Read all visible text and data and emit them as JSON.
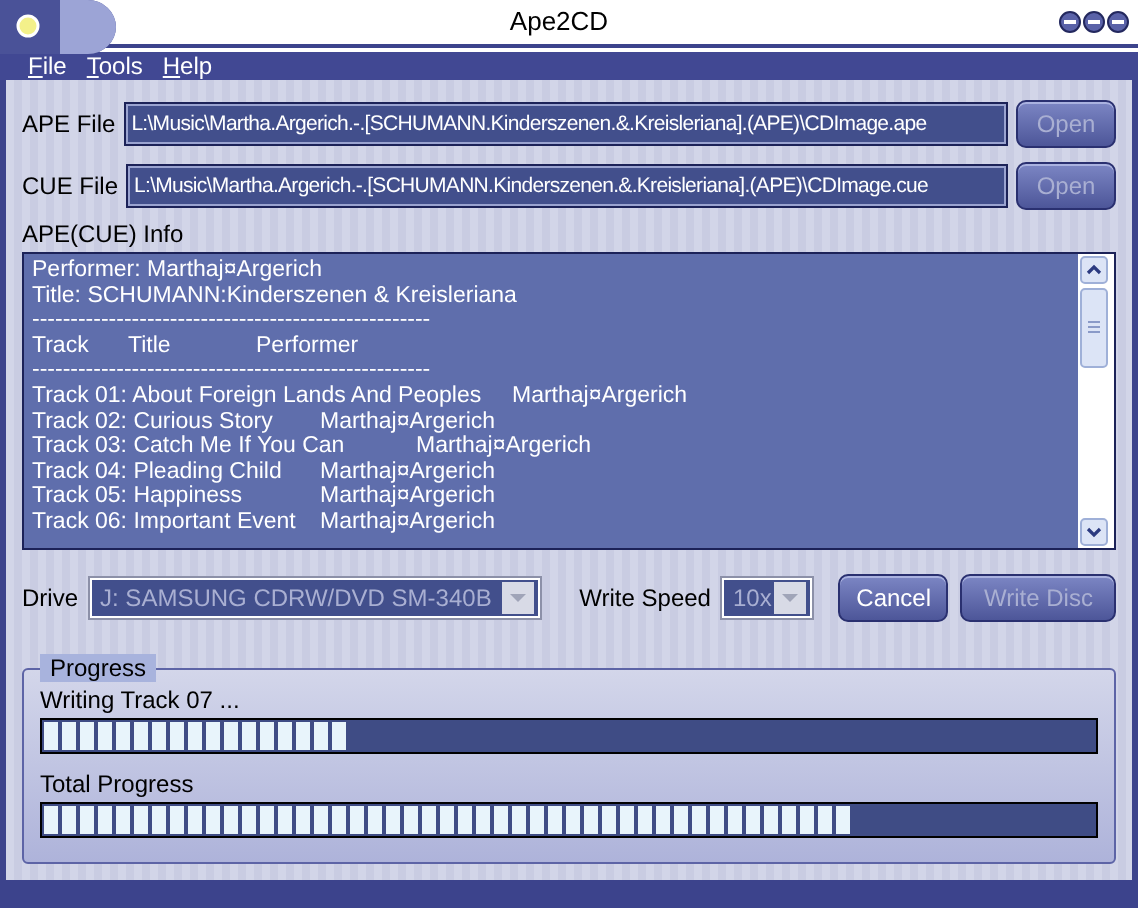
{
  "window": {
    "title": "Ape2CD"
  },
  "menu": [
    {
      "label": "File"
    },
    {
      "label": "Tools"
    },
    {
      "label": "Help"
    }
  ],
  "files": [
    {
      "label": "APE File",
      "value": "L:\\Music\\Martha.Argerich.-.[SCHUMANN.Kinderszenen.&.Kreisleriana].(APE)\\CDImage.ape",
      "button": {
        "label": "Open",
        "disabled": true
      }
    },
    {
      "label": "CUE File",
      "value": "L:\\Music\\Martha.Argerich.-.[SCHUMANN.Kinderszenen.&.Kreisleriana].(APE)\\CDImage.cue",
      "button": {
        "label": "Open",
        "disabled": true
      }
    }
  ],
  "info": {
    "label": "APE(CUE) Info",
    "lines": [
      {
        "kind": "text",
        "text": "Performer: Marthaj¤Argerich"
      },
      {
        "kind": "text",
        "text": "Title: SCHUMANN:Kinderszenen & Kreisleriana"
      },
      {
        "kind": "text",
        "text": "----------------------------------------------------"
      },
      {
        "kind": "header",
        "cols": [
          "Track",
          "Title",
          "Performer"
        ]
      },
      {
        "kind": "text",
        "text": "----------------------------------------------------"
      },
      {
        "kind": "track",
        "text": "Track 01: About Foreign Lands And Peoples",
        "performer": "Marthaj¤Argerich"
      },
      {
        "kind": "track",
        "text": "Track 02: Curious Story",
        "performer": "Marthaj¤Argerich"
      },
      {
        "kind": "track",
        "text": "Track 03: Catch Me If You Can",
        "performer": "Marthaj¤Argerich"
      },
      {
        "kind": "track",
        "text": "Track 04: Pleading Child",
        "performer": "Marthaj¤Argerich"
      },
      {
        "kind": "track",
        "text": "Track 05: Happiness",
        "performer": "Marthaj¤Argerich"
      },
      {
        "kind": "track",
        "text": "Track 06: Important Event",
        "performer": "Marthaj¤Argerich"
      }
    ]
  },
  "drive": {
    "label": "Drive",
    "value": "J: SAMSUNG CDRW/DVD SM-340B",
    "disabled": true
  },
  "speed": {
    "label": "Write Speed",
    "value": "10x",
    "disabled": true
  },
  "buttons": [
    {
      "label": "Cancel",
      "disabled": false
    },
    {
      "label": "Write Disc",
      "disabled": true
    }
  ],
  "progress": {
    "title": "Progress",
    "bars": [
      {
        "label": "Writing Track 07 ...",
        "level": 0.29
      },
      {
        "label": "Total Progress",
        "level": 0.77
      }
    ]
  }
}
